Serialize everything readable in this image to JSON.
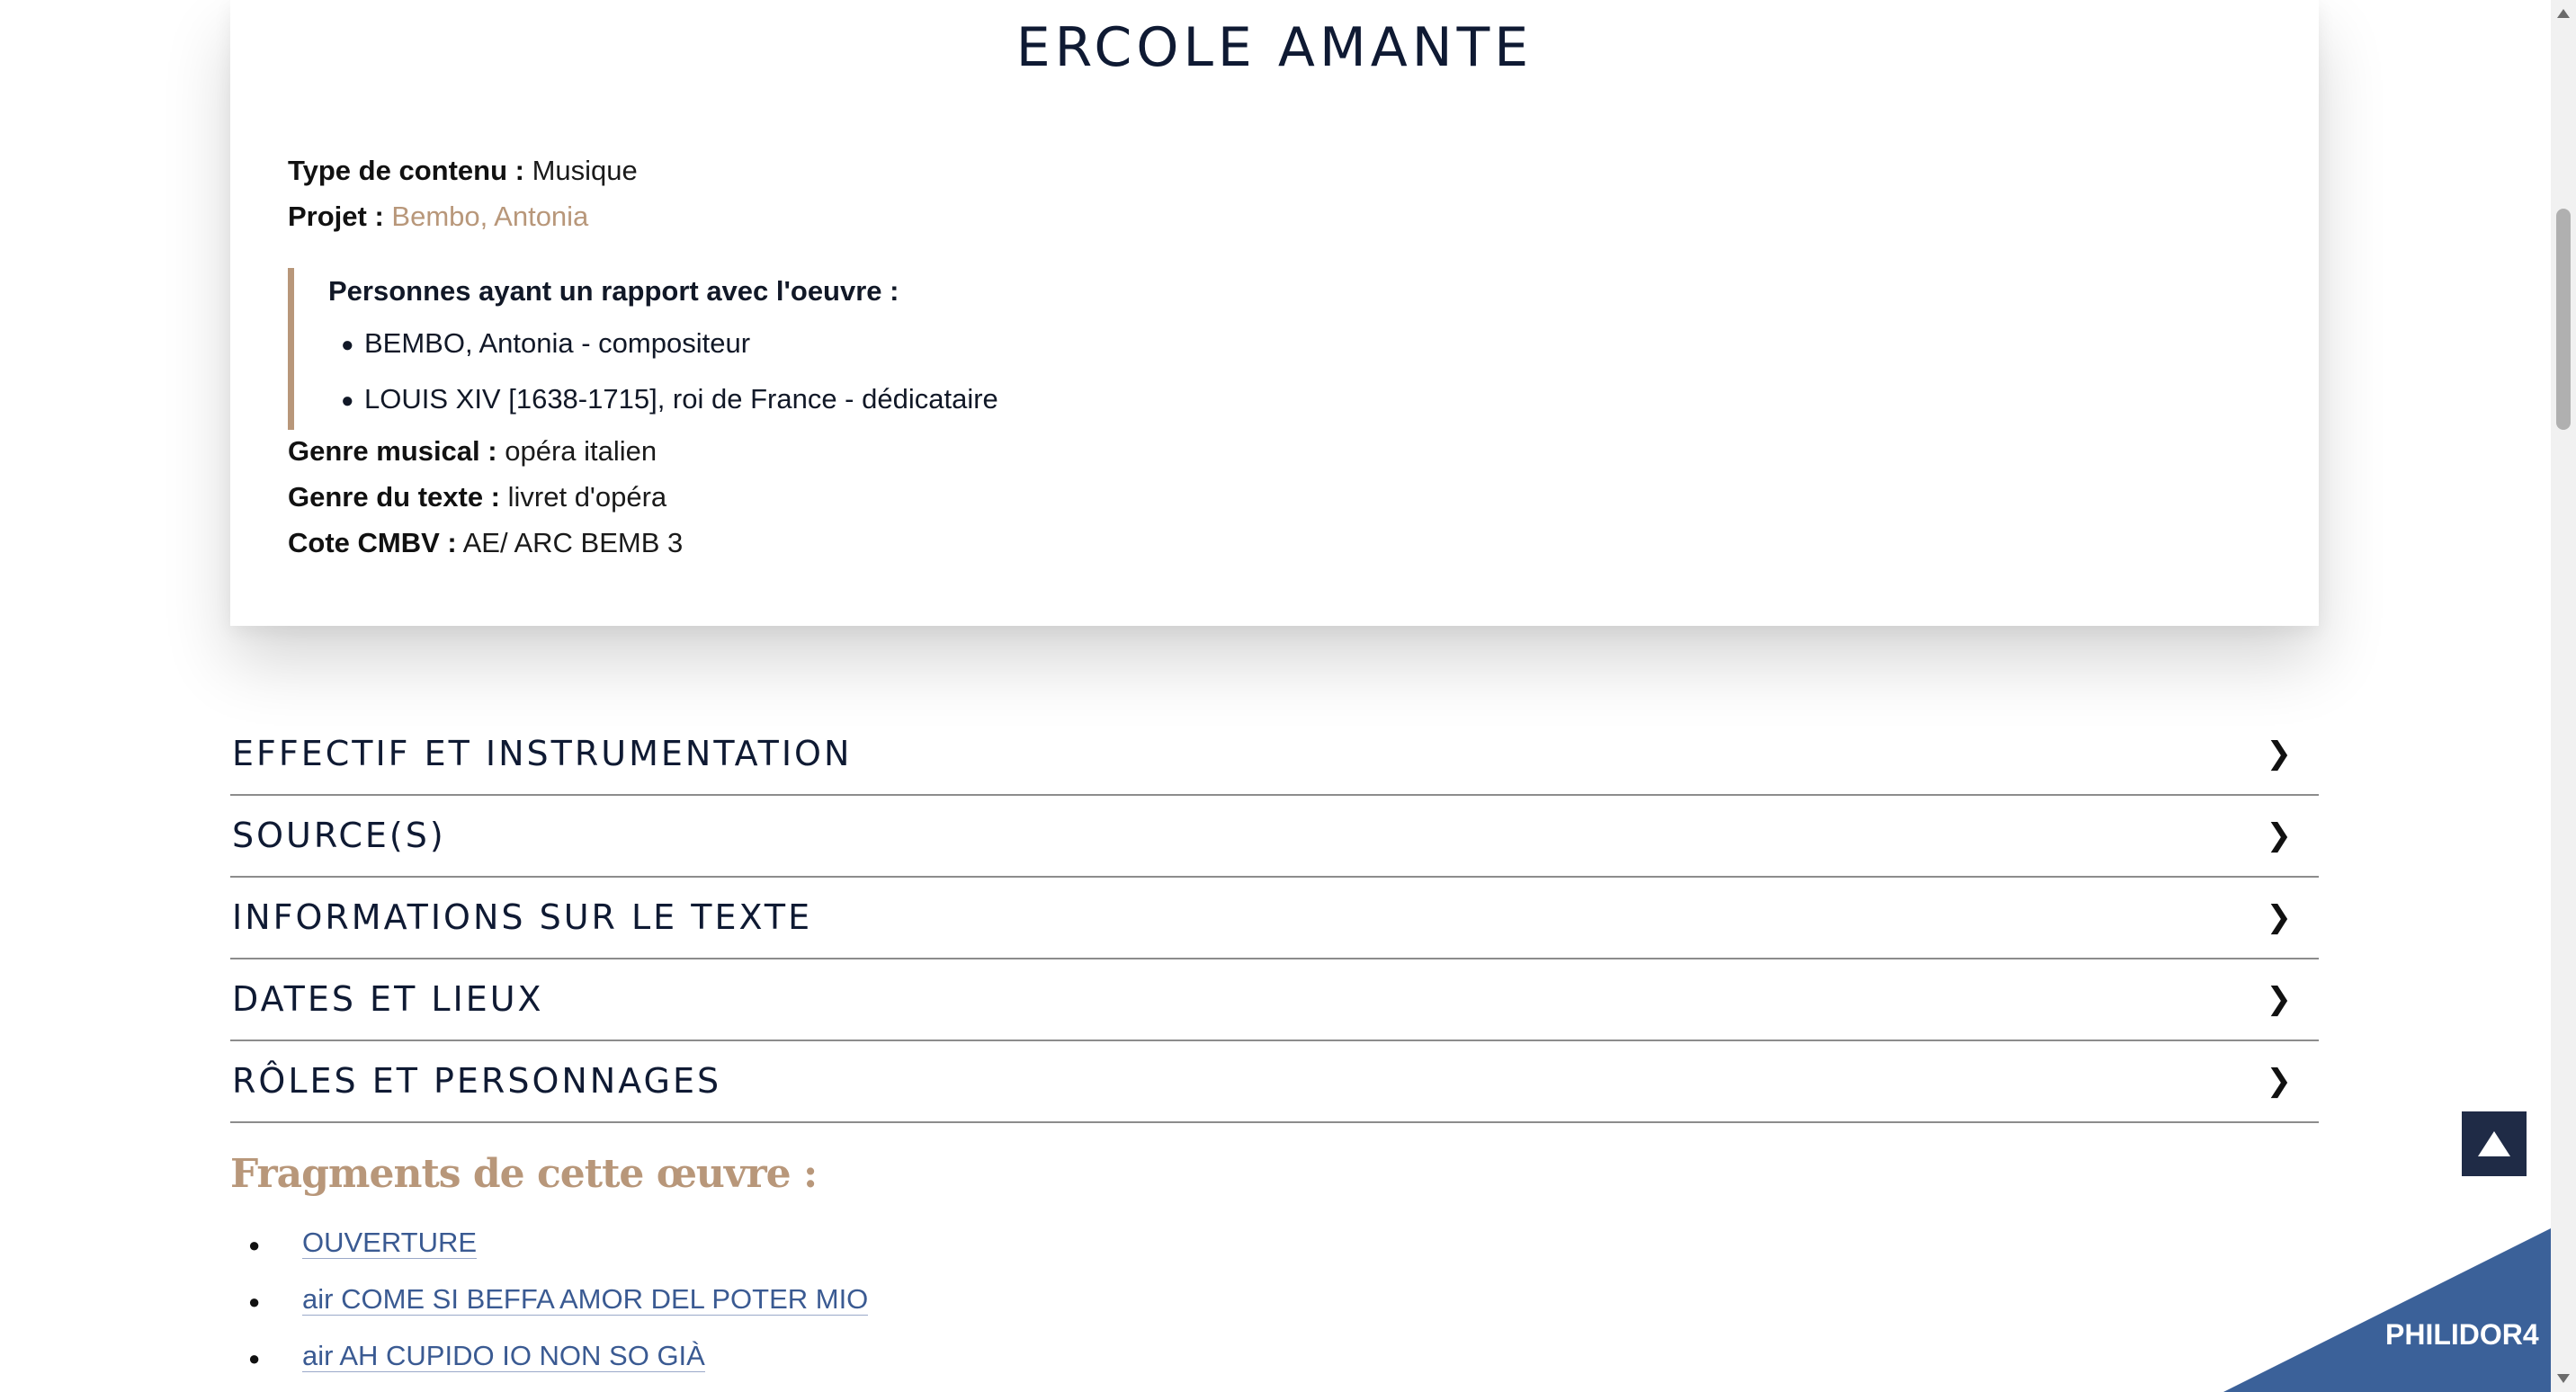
{
  "work": {
    "title": "ERCOLE AMANTE",
    "content_type_label": "Type de contenu :",
    "content_type_value": "Musique",
    "project_label": "Projet :",
    "project_value": "Bembo, Antonia",
    "persons_header": "Personnes ayant un rapport avec l'oeuvre :",
    "persons": [
      "BEMBO, Antonia - compositeur",
      "LOUIS XIV [1638-1715], roi de France - dédicataire"
    ],
    "genre_musical_label": "Genre musical :",
    "genre_musical_value": "opéra italien",
    "genre_texte_label": "Genre du texte :",
    "genre_texte_value": "livret d'opéra",
    "cote_label": "Cote CMBV :",
    "cote_value": "AE/ ARC BEMB 3"
  },
  "accordion": [
    {
      "label": "EFFECTIF ET INSTRUMENTATION"
    },
    {
      "label": "SOURCE(S)"
    },
    {
      "label": "INFORMATIONS SUR LE TEXTE"
    },
    {
      "label": "DATES ET LIEUX"
    },
    {
      "label": "RÔLES ET PERSONNAGES"
    }
  ],
  "chevron_glyph": "❯",
  "fragments": {
    "title": "Fragments de cette œuvre :",
    "items": [
      "OUVERTURE",
      "air COME SI BEFFA AMOR DEL POTER MIO",
      "air AH CUPIDO IO NON SO GIÀ"
    ]
  },
  "corner_label": "PHILIDOR4",
  "icons": {
    "back_to_top": "triangle-up-icon",
    "accordion": "chevron-right-icon"
  },
  "colors": {
    "accent": "#b8977a",
    "navy": "#1f2b46",
    "link": "#3a5a92",
    "corner": "#3b6199"
  }
}
